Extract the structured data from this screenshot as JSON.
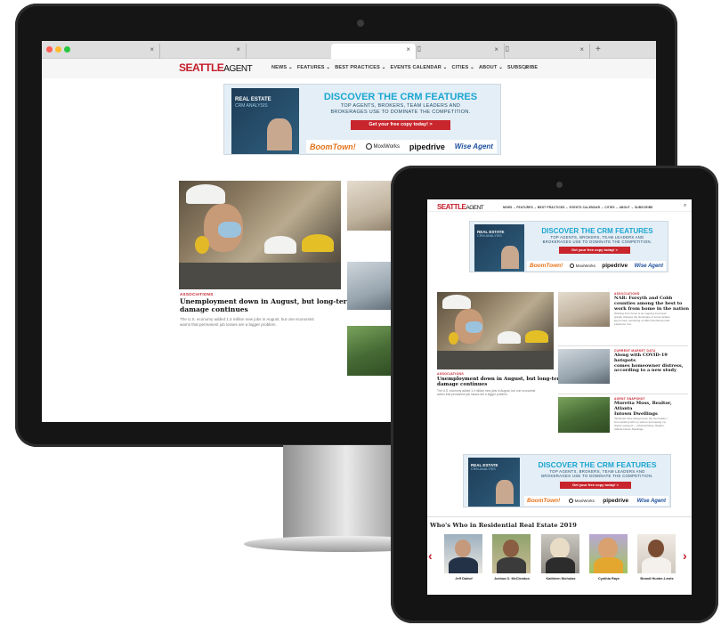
{
  "site": {
    "logo_main": "SEATTLE",
    "logo_sub": "AGENT",
    "logo_tag": "MAGAZINE",
    "nav": [
      "NEWS ⌄",
      "FEATURES ⌄",
      "BEST PRACTICES ⌄",
      "EVENTS CALENDAR ⌄",
      "CITIES ⌄",
      "ABOUT ⌄",
      "SUBSCRIBE"
    ],
    "nav_tablet": "NEWS ⌄  FEATURES ⌄  BEST PRACTICES ⌄  EVENTS CALENDAR ⌄  CITIES ⌄  ABOUT ⌄  SUBSCRIBE",
    "search_icon": "magnifier",
    "brand_red": "#c41e2a"
  },
  "browser": {
    "tab_close": "×",
    "new_tab": "+",
    "doc_icon": "document"
  },
  "ad": {
    "side_t1": "REAL ESTATE",
    "side_t2": "CRM ANALYSIS",
    "title": "DISCOVER THE CRM FEATURES",
    "sub1": "TOP AGENTS, BROKERS, TEAM LEADERS AND",
    "sub2": "BROKERAGES USE TO DOMINATE THE COMPETITION.",
    "button": "Get your free copy today! >",
    "sponsors": [
      "BoomTown!",
      "MoxiWorks",
      "pipedrive",
      "Wise Agent"
    ]
  },
  "feature": {
    "category": "ASSOCIATIONS",
    "headline_1": "Unemployment down in August, but long-term",
    "headline_2": "damage continues",
    "excerpt_1": "The U.S. economy added 1.4 million new jobs in August, but one economist",
    "excerpt_2": "warns that permanent job losses are a bigger problem."
  },
  "sidebar": [
    {
      "category": "ASSOCIATIONS",
      "lines": [
        "NAR: Forsyth and Cobb",
        "counties among the best to",
        "work from home in the nation"
      ],
      "excerpt": [
        "Working from home is an ongoing trend and",
        "greatly changes the landscape of some locales,",
        "key homes, according to NAR Chief Economist",
        "Lawrence Yun."
      ]
    },
    {
      "category": "CURRENT MARKET DATA",
      "lines": [
        "Along with COVID-19 hotspots",
        "comes homeowner distress,",
        "according to a new study"
      ],
      "excerpt": [
        "..."
      ]
    },
    {
      "category": "AGENT SNAPSHOT",
      "lines": [
        "Muretta Moss, Realtor, Atlanta",
        "Intown Dwellings"
      ],
      "excerpt": [
        "\"Referrals have always been the best leads. I",
        "love working with my sphere and seeing my",
        "clients succeed.\" —Muretta Moss, Realtor,",
        "Atlanta Intown Dwellings"
      ]
    }
  ],
  "whos_who": {
    "title": "Who's Who in Residential Real Estate 2019",
    "people": [
      "Jeff Daleuf",
      "Joshua O. McClendon",
      "Kathleen Nicholas",
      "Cynthia Raye",
      "Brandi Hunter-Lewis"
    ],
    "prev": "‹",
    "next": "›"
  }
}
